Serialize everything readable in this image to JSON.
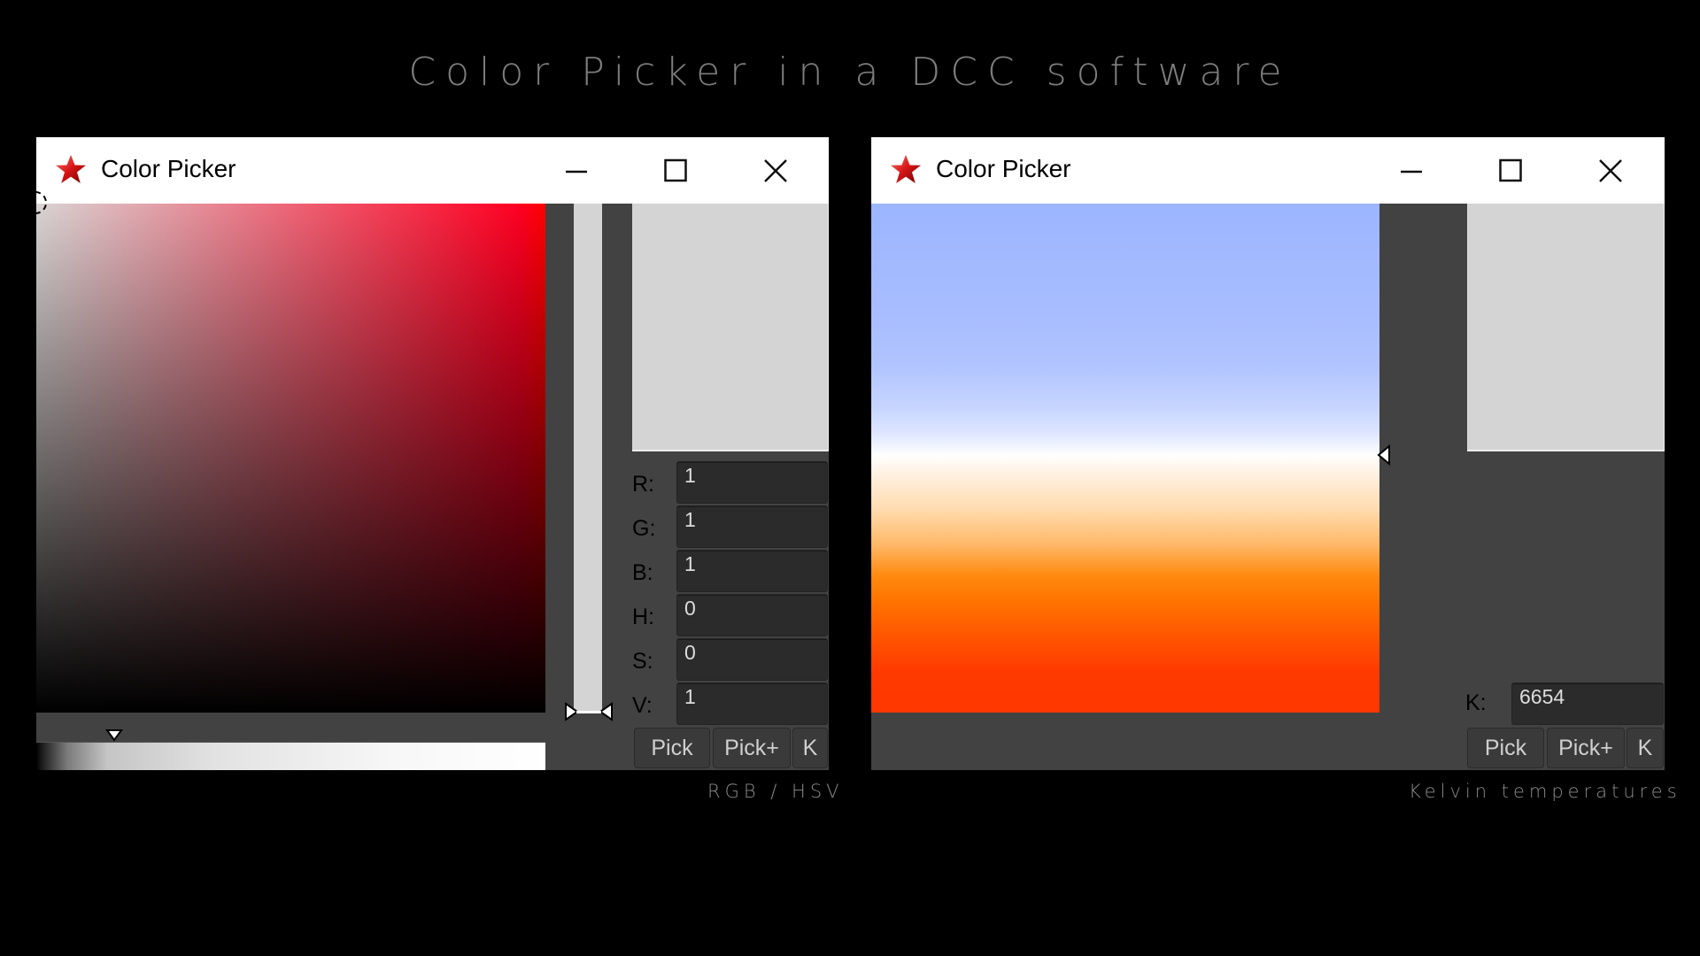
{
  "page": {
    "title": "Color Picker in a DCC software",
    "captions": {
      "left": "RGB / HSV",
      "right": "Kelvin temperatures"
    }
  },
  "colors": {
    "background": "#000000",
    "window_body": "#424242",
    "field_bg": "#2b2b2b",
    "swatch": "#d4d4d4",
    "hue_red": "#ff0000"
  },
  "windows": [
    {
      "id": "rgb-hsv",
      "title": "Color Picker",
      "icon": "star-icon",
      "controls": {
        "minimize": "minimize-icon",
        "maximize": "maximize-icon",
        "close": "close-icon"
      },
      "fields": [
        {
          "label": "R:",
          "value": "1"
        },
        {
          "label": "G:",
          "value": "1"
        },
        {
          "label": "B:",
          "value": "1"
        },
        {
          "label": "H:",
          "value": "0"
        },
        {
          "label": "S:",
          "value": "0"
        },
        {
          "label": "V:",
          "value": "1"
        }
      ],
      "buttons": [
        "Pick",
        "Pick+",
        "K"
      ],
      "value_slider": {
        "value": 1.0
      },
      "saturation_marker": {
        "s": 0,
        "v": 1
      }
    },
    {
      "id": "kelvin",
      "title": "Color Picker",
      "icon": "star-icon",
      "controls": {
        "minimize": "minimize-icon",
        "maximize": "maximize-icon",
        "close": "close-icon"
      },
      "fields": [
        {
          "label": "K:",
          "value": "6654"
        }
      ],
      "buttons": [
        "Pick",
        "Pick+",
        "K"
      ]
    }
  ]
}
